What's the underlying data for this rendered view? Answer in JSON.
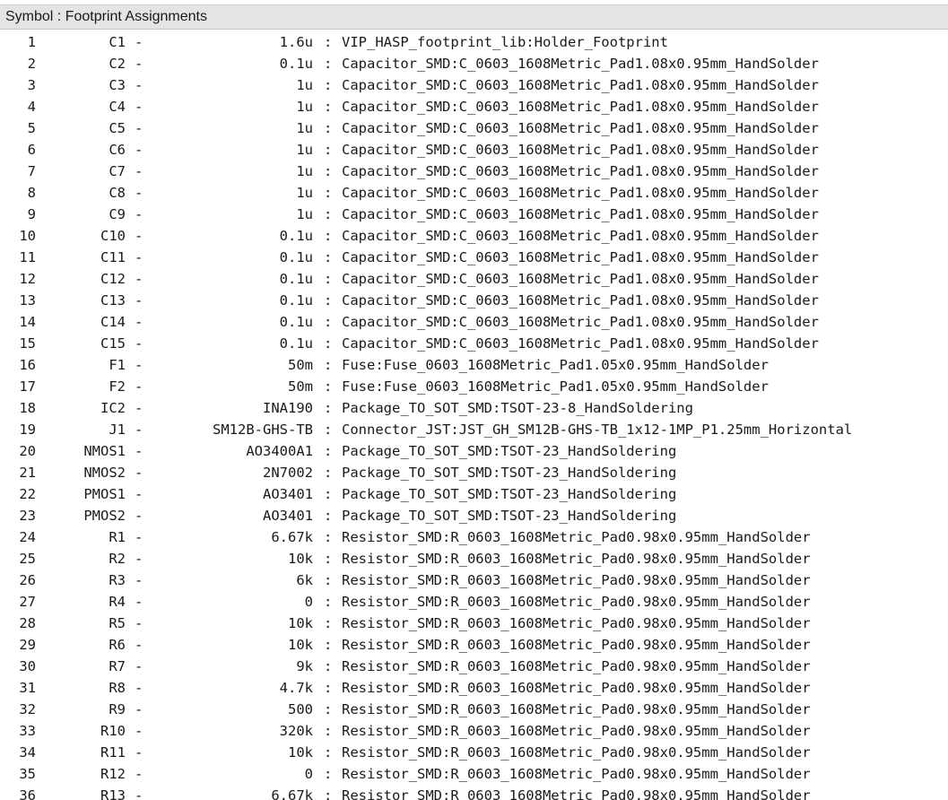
{
  "panel": {
    "title": "Symbol : Footprint Assignments"
  },
  "separator": "-",
  "colon": ":",
  "rows": [
    {
      "index": "1",
      "ref": "C1",
      "value": "1.6u",
      "footprint": "VIP_HASP_footprint_lib:Holder_Footprint"
    },
    {
      "index": "2",
      "ref": "C2",
      "value": "0.1u",
      "footprint": "Capacitor_SMD:C_0603_1608Metric_Pad1.08x0.95mm_HandSolder"
    },
    {
      "index": "3",
      "ref": "C3",
      "value": "1u",
      "footprint": "Capacitor_SMD:C_0603_1608Metric_Pad1.08x0.95mm_HandSolder"
    },
    {
      "index": "4",
      "ref": "C4",
      "value": "1u",
      "footprint": "Capacitor_SMD:C_0603_1608Metric_Pad1.08x0.95mm_HandSolder"
    },
    {
      "index": "5",
      "ref": "C5",
      "value": "1u",
      "footprint": "Capacitor_SMD:C_0603_1608Metric_Pad1.08x0.95mm_HandSolder"
    },
    {
      "index": "6",
      "ref": "C6",
      "value": "1u",
      "footprint": "Capacitor_SMD:C_0603_1608Metric_Pad1.08x0.95mm_HandSolder"
    },
    {
      "index": "7",
      "ref": "C7",
      "value": "1u",
      "footprint": "Capacitor_SMD:C_0603_1608Metric_Pad1.08x0.95mm_HandSolder"
    },
    {
      "index": "8",
      "ref": "C8",
      "value": "1u",
      "footprint": "Capacitor_SMD:C_0603_1608Metric_Pad1.08x0.95mm_HandSolder"
    },
    {
      "index": "9",
      "ref": "C9",
      "value": "1u",
      "footprint": "Capacitor_SMD:C_0603_1608Metric_Pad1.08x0.95mm_HandSolder"
    },
    {
      "index": "10",
      "ref": "C10",
      "value": "0.1u",
      "footprint": "Capacitor_SMD:C_0603_1608Metric_Pad1.08x0.95mm_HandSolder"
    },
    {
      "index": "11",
      "ref": "C11",
      "value": "0.1u",
      "footprint": "Capacitor_SMD:C_0603_1608Metric_Pad1.08x0.95mm_HandSolder"
    },
    {
      "index": "12",
      "ref": "C12",
      "value": "0.1u",
      "footprint": "Capacitor_SMD:C_0603_1608Metric_Pad1.08x0.95mm_HandSolder"
    },
    {
      "index": "13",
      "ref": "C13",
      "value": "0.1u",
      "footprint": "Capacitor_SMD:C_0603_1608Metric_Pad1.08x0.95mm_HandSolder"
    },
    {
      "index": "14",
      "ref": "C14",
      "value": "0.1u",
      "footprint": "Capacitor_SMD:C_0603_1608Metric_Pad1.08x0.95mm_HandSolder"
    },
    {
      "index": "15",
      "ref": "C15",
      "value": "0.1u",
      "footprint": "Capacitor_SMD:C_0603_1608Metric_Pad1.08x0.95mm_HandSolder"
    },
    {
      "index": "16",
      "ref": "F1",
      "value": "50m",
      "footprint": "Fuse:Fuse_0603_1608Metric_Pad1.05x0.95mm_HandSolder"
    },
    {
      "index": "17",
      "ref": "F2",
      "value": "50m",
      "footprint": "Fuse:Fuse_0603_1608Metric_Pad1.05x0.95mm_HandSolder"
    },
    {
      "index": "18",
      "ref": "IC2",
      "value": "INA190",
      "footprint": "Package_TO_SOT_SMD:TSOT-23-8_HandSoldering"
    },
    {
      "index": "19",
      "ref": "J1",
      "value": "SM12B-GHS-TB",
      "footprint": "Connector_JST:JST_GH_SM12B-GHS-TB_1x12-1MP_P1.25mm_Horizontal"
    },
    {
      "index": "20",
      "ref": "NMOS1",
      "value": "AO3400A1",
      "footprint": "Package_TO_SOT_SMD:TSOT-23_HandSoldering"
    },
    {
      "index": "21",
      "ref": "NMOS2",
      "value": "2N7002",
      "footprint": "Package_TO_SOT_SMD:TSOT-23_HandSoldering"
    },
    {
      "index": "22",
      "ref": "PMOS1",
      "value": "AO3401",
      "footprint": "Package_TO_SOT_SMD:TSOT-23_HandSoldering"
    },
    {
      "index": "23",
      "ref": "PMOS2",
      "value": "AO3401",
      "footprint": "Package_TO_SOT_SMD:TSOT-23_HandSoldering"
    },
    {
      "index": "24",
      "ref": "R1",
      "value": "6.67k",
      "footprint": "Resistor_SMD:R_0603_1608Metric_Pad0.98x0.95mm_HandSolder"
    },
    {
      "index": "25",
      "ref": "R2",
      "value": "10k",
      "footprint": "Resistor_SMD:R_0603_1608Metric_Pad0.98x0.95mm_HandSolder"
    },
    {
      "index": "26",
      "ref": "R3",
      "value": "6k",
      "footprint": "Resistor_SMD:R_0603_1608Metric_Pad0.98x0.95mm_HandSolder"
    },
    {
      "index": "27",
      "ref": "R4",
      "value": "0",
      "footprint": "Resistor_SMD:R_0603_1608Metric_Pad0.98x0.95mm_HandSolder"
    },
    {
      "index": "28",
      "ref": "R5",
      "value": "10k",
      "footprint": "Resistor_SMD:R_0603_1608Metric_Pad0.98x0.95mm_HandSolder"
    },
    {
      "index": "29",
      "ref": "R6",
      "value": "10k",
      "footprint": "Resistor_SMD:R_0603_1608Metric_Pad0.98x0.95mm_HandSolder"
    },
    {
      "index": "30",
      "ref": "R7",
      "value": "9k",
      "footprint": "Resistor_SMD:R_0603_1608Metric_Pad0.98x0.95mm_HandSolder"
    },
    {
      "index": "31",
      "ref": "R8",
      "value": "4.7k",
      "footprint": "Resistor_SMD:R_0603_1608Metric_Pad0.98x0.95mm_HandSolder"
    },
    {
      "index": "32",
      "ref": "R9",
      "value": "500",
      "footprint": "Resistor_SMD:R_0603_1608Metric_Pad0.98x0.95mm_HandSolder"
    },
    {
      "index": "33",
      "ref": "R10",
      "value": "320k",
      "footprint": "Resistor_SMD:R_0603_1608Metric_Pad0.98x0.95mm_HandSolder"
    },
    {
      "index": "34",
      "ref": "R11",
      "value": "10k",
      "footprint": "Resistor_SMD:R_0603_1608Metric_Pad0.98x0.95mm_HandSolder"
    },
    {
      "index": "35",
      "ref": "R12",
      "value": "0",
      "footprint": "Resistor_SMD:R_0603_1608Metric_Pad0.98x0.95mm_HandSolder"
    },
    {
      "index": "36",
      "ref": "R13",
      "value": "6.67k",
      "footprint": "Resistor_SMD:R_0603_1608Metric_Pad0.98x0.95mm_HandSolder"
    }
  ]
}
